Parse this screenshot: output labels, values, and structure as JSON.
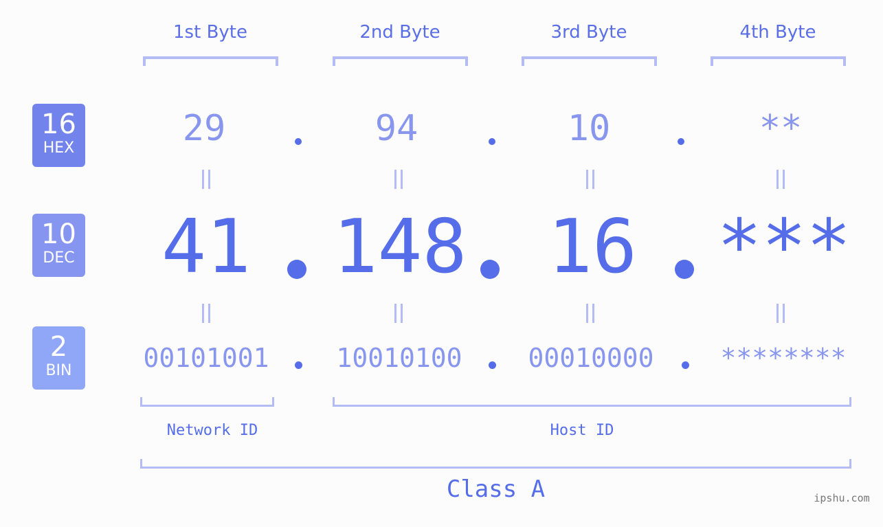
{
  "bytes": {
    "headers": [
      "1st Byte",
      "2nd Byte",
      "3rd Byte",
      "4th Byte"
    ]
  },
  "badges": {
    "hex": {
      "base": "16",
      "label": "HEX",
      "color": "#7383ec"
    },
    "dec": {
      "base": "10",
      "label": "DEC",
      "color": "#8595f0"
    },
    "bin": {
      "base": "2",
      "label": "BIN",
      "color": "#8fa7f6"
    }
  },
  "ip": {
    "hex": [
      "29",
      "94",
      "10",
      "**"
    ],
    "dec": [
      "41",
      "148",
      "16",
      "***"
    ],
    "bin": [
      "00101001",
      "10010100",
      "00010000",
      "********"
    ]
  },
  "equals_symbol": "=",
  "segments": {
    "network_label": "Network ID",
    "host_label": "Host ID",
    "class_label": "Class A"
  },
  "watermark": "ipshu.com",
  "colors": {
    "accent": "#566de9",
    "light_text": "#8896ee",
    "bracket": "#b3bcf5",
    "background": "#fbfcfb"
  }
}
